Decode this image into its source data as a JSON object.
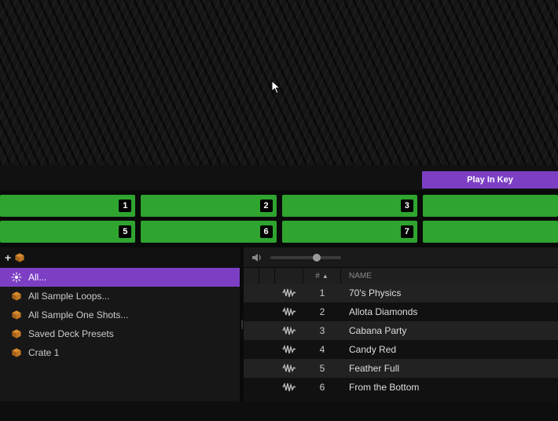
{
  "action_button": {
    "label": "Play In Key"
  },
  "pads": {
    "row1": [
      "1",
      "2",
      "3",
      ""
    ],
    "row2": [
      "5",
      "6",
      "7",
      ""
    ]
  },
  "left": {
    "add_label": "+",
    "crates": [
      {
        "type": "all",
        "label": "All...",
        "selected": true
      },
      {
        "type": "crate",
        "label": "All Sample Loops...",
        "selected": false
      },
      {
        "type": "crate",
        "label": "All Sample One Shots...",
        "selected": false
      },
      {
        "type": "crate",
        "label": "Saved Deck Presets",
        "selected": false
      },
      {
        "type": "crate",
        "label": "Crate 1",
        "selected": false
      }
    ]
  },
  "volume": {
    "percent": 65
  },
  "table": {
    "headers": {
      "num": "#",
      "name": "NAME"
    },
    "rows": [
      {
        "num": "1",
        "name": "70's Physics"
      },
      {
        "num": "2",
        "name": "Allota Diamonds"
      },
      {
        "num": "3",
        "name": "Cabana Party"
      },
      {
        "num": "4",
        "name": "Candy Red"
      },
      {
        "num": "5",
        "name": "Feather Full"
      },
      {
        "num": "6",
        "name": "From the Bottom"
      }
    ]
  }
}
